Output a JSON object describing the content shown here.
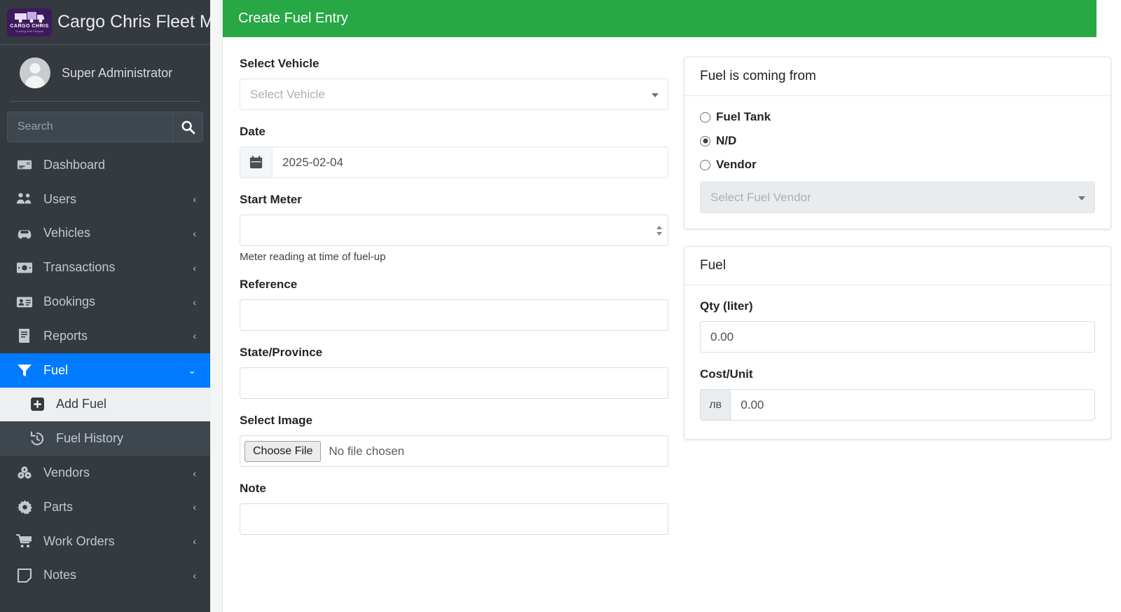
{
  "sidebar": {
    "brand": {
      "title": "Cargo Chris Fleet Man",
      "logo_text": "CARGO CHRIS",
      "logo_sub": "Trucking With Chrisper"
    },
    "user": {
      "name": "Super Administrator"
    },
    "search": {
      "placeholder": "Search"
    },
    "items": [
      {
        "label": "Dashboard",
        "icon": "dashboard-icon",
        "arrow": ""
      },
      {
        "label": "Users",
        "icon": "users-icon",
        "arrow": "‹"
      },
      {
        "label": "Vehicles",
        "icon": "car-icon",
        "arrow": "‹"
      },
      {
        "label": "Transactions",
        "icon": "money-icon",
        "arrow": "‹"
      },
      {
        "label": "Bookings",
        "icon": "id-card-icon",
        "arrow": "‹"
      },
      {
        "label": "Reports",
        "icon": "book-icon",
        "arrow": "‹"
      },
      {
        "label": "Fuel",
        "icon": "funnel-icon",
        "arrow": "⌄",
        "active": true
      },
      {
        "label": "Vendors",
        "icon": "boxes-icon",
        "arrow": "‹"
      },
      {
        "label": "Parts",
        "icon": "gear-icon",
        "arrow": "‹"
      },
      {
        "label": "Work Orders",
        "icon": "cart-icon",
        "arrow": "‹"
      },
      {
        "label": "Notes",
        "icon": "note-icon",
        "arrow": "‹"
      }
    ],
    "fuel_sub": [
      {
        "label": "Add Fuel",
        "icon": "plus-square-icon",
        "active": true
      },
      {
        "label": "Fuel History",
        "icon": "history-icon",
        "active": false
      }
    ]
  },
  "page": {
    "header_title": "Create Fuel Entry"
  },
  "form": {
    "select_vehicle": {
      "label": "Select Vehicle",
      "placeholder": "Select Vehicle"
    },
    "date": {
      "label": "Date",
      "value": "2025-02-04"
    },
    "start_meter": {
      "label": "Start Meter",
      "value": "",
      "help": "Meter reading at time of fuel-up"
    },
    "reference": {
      "label": "Reference",
      "value": ""
    },
    "state_province": {
      "label": "State/Province",
      "value": ""
    },
    "select_image": {
      "label": "Select Image",
      "button": "Choose File",
      "file_status": "No file chosen"
    },
    "note": {
      "label": "Note",
      "value": ""
    }
  },
  "source_card": {
    "title": "Fuel is coming from",
    "options": [
      {
        "label": "Fuel Tank",
        "selected": false
      },
      {
        "label": "N/D",
        "selected": true
      },
      {
        "label": "Vendor",
        "selected": false
      }
    ],
    "vendor_select": {
      "placeholder": "Select Fuel Vendor",
      "disabled": true
    }
  },
  "fuel_card": {
    "title": "Fuel",
    "qty": {
      "label": "Qty (liter)",
      "value": "0.00"
    },
    "cost_unit": {
      "label": "Cost/Unit",
      "currency": "лв",
      "value": "0.00"
    }
  },
  "colors": {
    "sidebar_bg": "#343a40",
    "accent_blue": "#007bff",
    "header_green": "#28a745",
    "logo_purple": "#3d1a5b"
  }
}
